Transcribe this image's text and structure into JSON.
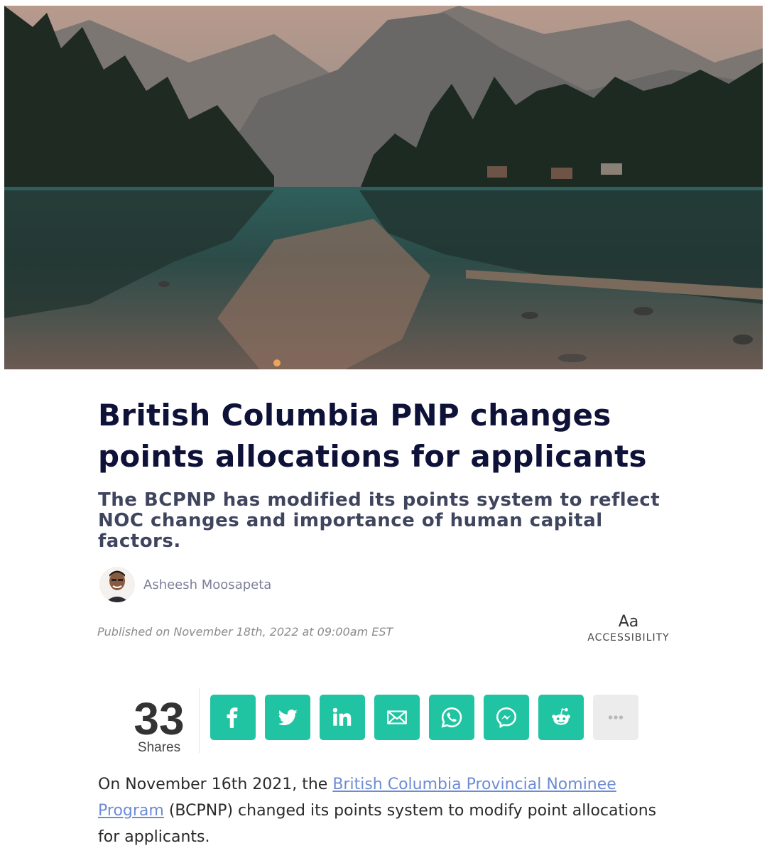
{
  "hero": {
    "alt_icon": "landscape-photo"
  },
  "article": {
    "title": "British Columbia PNP changes points allocations for applicants",
    "subtitle": "The BCPNP has modified its points system to reflect NOC changes and importance of human capital factors.",
    "author": "Asheesh Moosapeta",
    "published": "Published on November 18th, 2022 at 09:00am EST",
    "body": {
      "before_link": "On November 16th 2021, the ",
      "link_text": "British Columbia Provincial Nominee Program",
      "after_link": " (BCPNP) changed its points system to modify point allocations for applicants."
    }
  },
  "accessibility": {
    "icon_text": "Aa",
    "label": "ACCESSIBILITY"
  },
  "share": {
    "count": "33",
    "label": "Shares",
    "accent_color": "#20c4a2",
    "buttons": [
      {
        "icon": "facebook-icon"
      },
      {
        "icon": "twitter-icon"
      },
      {
        "icon": "linkedin-icon"
      },
      {
        "icon": "email-icon"
      },
      {
        "icon": "whatsapp-icon"
      },
      {
        "icon": "messenger-icon"
      },
      {
        "icon": "reddit-icon"
      },
      {
        "icon": "more-icon"
      }
    ]
  }
}
